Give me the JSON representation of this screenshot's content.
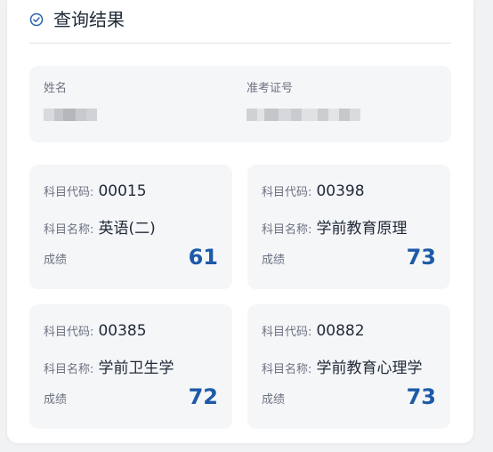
{
  "header": {
    "title": "查询结果",
    "icon": "check-circle-icon"
  },
  "info": {
    "name_label": "姓名",
    "ticket_label": "准考证号"
  },
  "subjects": [
    {
      "code_label": "科目代码:",
      "code": "00015",
      "name_label": "科目名称:",
      "name": "英语(二)",
      "score_label": "成绩",
      "score": "61"
    },
    {
      "code_label": "科目代码:",
      "code": "00398",
      "name_label": "科目名称:",
      "name": "学前教育原理",
      "score_label": "成绩",
      "score": "73"
    },
    {
      "code_label": "科目代码:",
      "code": "00385",
      "name_label": "科目名称:",
      "name": "学前卫生学",
      "score_label": "成绩",
      "score": "72"
    },
    {
      "code_label": "科目代码:",
      "code": "00882",
      "name_label": "科目名称:",
      "name": "学前教育心理学",
      "score_label": "成绩",
      "score": "73"
    }
  ],
  "colors": {
    "score": "#1d5aa8",
    "accent": "#2b5fad"
  }
}
